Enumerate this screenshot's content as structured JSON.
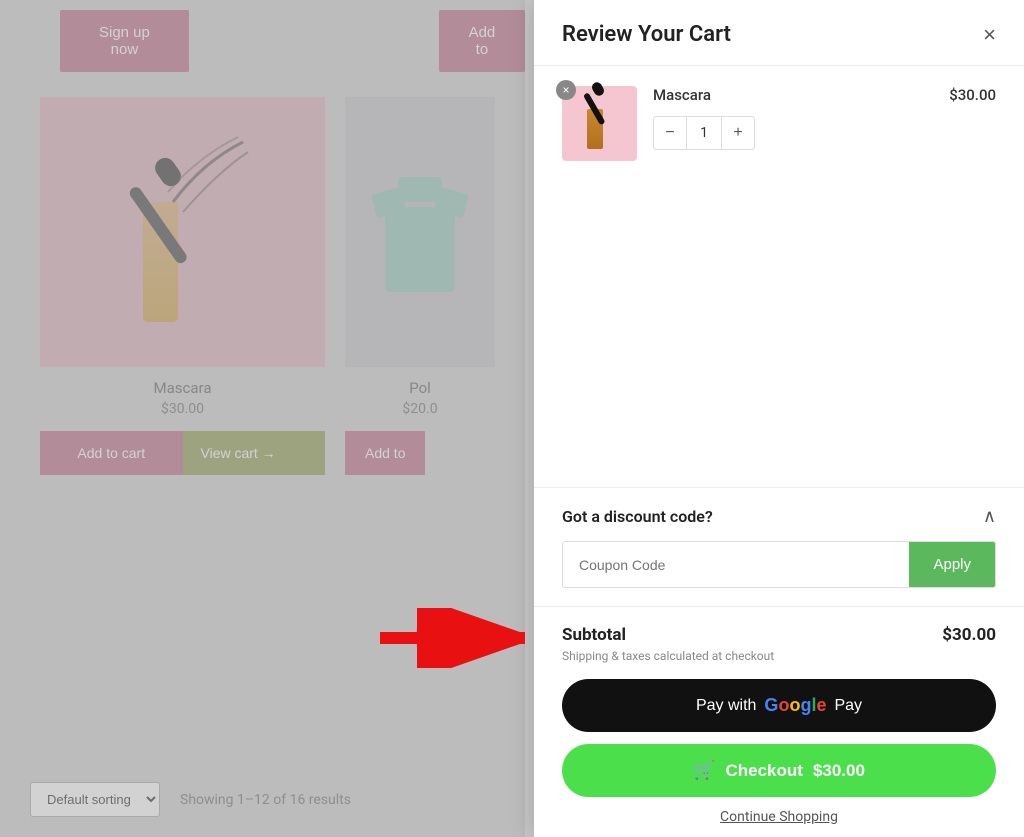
{
  "cart": {
    "title": "Review Your Cart",
    "close_label": "×",
    "item": {
      "name": "Mascara",
      "price": "$30.00",
      "quantity": 1,
      "remove_label": "×"
    },
    "discount": {
      "title": "Got a discount code?",
      "coupon_placeholder": "Coupon Code",
      "apply_label": "Apply"
    },
    "subtotal": {
      "label": "Subtotal",
      "amount": "$30.00",
      "shipping_note": "Shipping & taxes calculated at checkout"
    },
    "gpay_label": "Pay with",
    "gpay_suffix": "Pay",
    "checkout_label": "Checkout",
    "checkout_amount": "$30.00",
    "continue_label": "Continue Shopping"
  },
  "shop": {
    "signup_label": "Sign up now",
    "add_to_label": "Add to",
    "product1": {
      "name": "Mascara",
      "price": "$30.00",
      "add_cart": "Add to cart",
      "view_cart": "View cart →"
    },
    "product2": {
      "name": "Pol",
      "price": "$20.0"
    },
    "add_to2": "Add to",
    "sorting": {
      "label": "Default sorting",
      "results": "Showing 1–12 of 16 results"
    }
  }
}
